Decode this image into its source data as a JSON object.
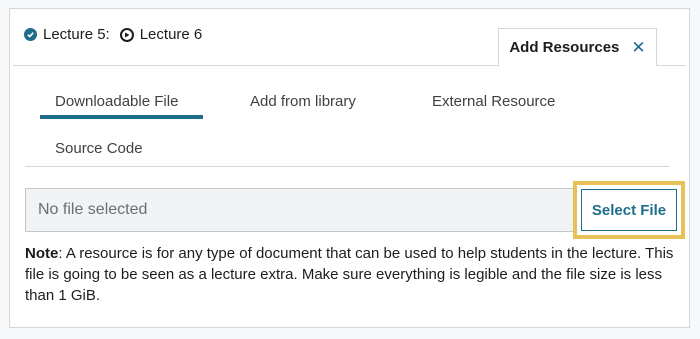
{
  "breadcrumb": {
    "items": [
      {
        "label": "Lecture 5:",
        "icon": "check-circle-icon"
      },
      {
        "label": "Lecture 6",
        "icon": "play-circle-icon"
      }
    ]
  },
  "panel": {
    "title": "Add Resources",
    "close_icon": "close-icon"
  },
  "tabs": [
    {
      "label": "Downloadable File",
      "active": true
    },
    {
      "label": "Add from library",
      "active": false
    },
    {
      "label": "External Resource",
      "active": false
    },
    {
      "label": "Source Code",
      "active": false
    }
  ],
  "file_input": {
    "value": "No file selected",
    "button_label": "Select File"
  },
  "note": {
    "label": "Note",
    "text": ": A resource is for any type of document that can be used to help students in the lecture. This file is going to be seen as a lecture extra. Make sure everything is legible and the file size is less than 1 GiB."
  },
  "colors": {
    "accent": "#1e6e8b",
    "highlight": "#e8c15a",
    "border": "#d1d7dc"
  }
}
